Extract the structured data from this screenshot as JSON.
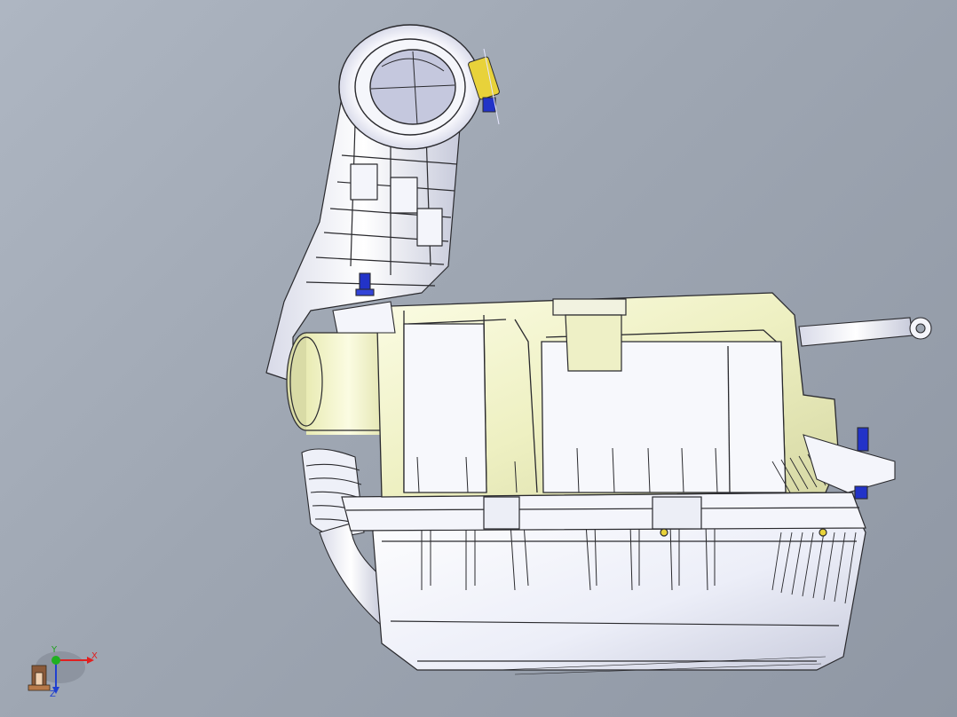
{
  "viewport": {
    "background_top": "#aeb6c2",
    "background_bottom": "#8f97a4"
  },
  "model": {
    "housing_color": "#f0f2c8",
    "body_color": "#f4f5fb",
    "edge_color": "#2a2a2e",
    "fastener_color": "#2233c8",
    "clip_color": "#e8d23a"
  },
  "triad": {
    "x_label": "X",
    "y_label": "Y",
    "z_label": "Z",
    "x_color": "#e02020",
    "y_color": "#20b020",
    "z_color": "#2040d0"
  }
}
